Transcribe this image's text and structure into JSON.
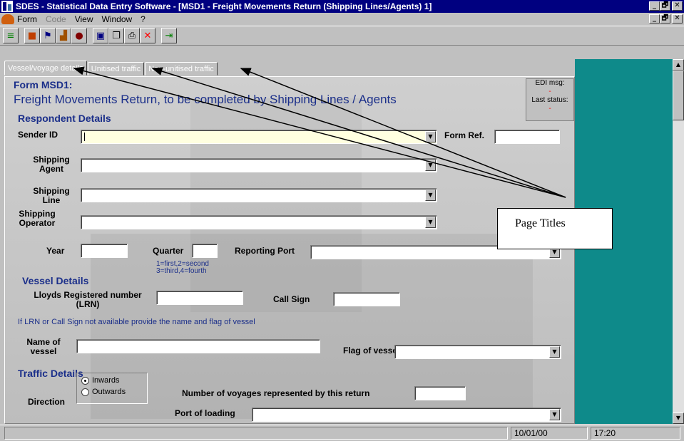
{
  "window": {
    "title": "SDES - Statistical Data Entry Software - [MSD1 - Freight Movements Return (Shipping Lines/Agents) 1]",
    "controls": {
      "minimize": "_",
      "restore": "🗗",
      "close": "✕"
    }
  },
  "menu": {
    "items": [
      {
        "label": "Form",
        "enabled": true
      },
      {
        "label": "Code",
        "enabled": false
      },
      {
        "label": "View",
        "enabled": true
      },
      {
        "label": "Window",
        "enabled": true
      },
      {
        "label": "?",
        "enabled": true
      }
    ]
  },
  "toolbar": {
    "icons": [
      "index-icon",
      "package-icon",
      "flag-icon",
      "chart-icon",
      "gear-icon",
      "save-icon",
      "copy-icon",
      "print-icon",
      "delete-icon",
      "exit-icon"
    ]
  },
  "tabs": [
    {
      "label": "Vessel/voyage details",
      "active": true
    },
    {
      "label": "Unitised traffic",
      "active": false
    },
    {
      "label": "Non-unitised traffic",
      "active": false
    }
  ],
  "form": {
    "code": "Form MSD1:",
    "subtitle": "Freight Movements Return, to be completed by Shipping Lines / Agents",
    "edi": {
      "msg_label": "EDI msg:",
      "msg_value": "-",
      "status_label": "Last status:",
      "status_value": "-"
    },
    "respondent": {
      "heading": "Respondent Details",
      "sender_id_label": "Sender ID",
      "sender_id_value": "",
      "form_ref_label": "Form Ref.",
      "shipping_agent_label_1": "Shipping",
      "shipping_agent_label_2": "Agent",
      "shipping_line_label_1": "Shipping",
      "shipping_line_label_2": "Line",
      "shipping_operator_label_1": "Shipping",
      "shipping_operator_label_2": "Operator",
      "year_label": "Year",
      "quarter_label": "Quarter",
      "quarter_hint_1": "1=first,2=second",
      "quarter_hint_2": "3=third,4=fourth",
      "reporting_port_label": "Reporting Port"
    },
    "vessel": {
      "heading": "Vessel Details",
      "lrn_label_1": "Lloyds Registered number",
      "lrn_label_2": "(LRN)",
      "call_sign_label": "Call Sign",
      "note": "If LRN or Call Sign not available provide the name and flag of vessel",
      "name_label_1": "Name of",
      "name_label_2": "vessel",
      "flag_label": "Flag of vessel"
    },
    "traffic": {
      "heading": "Traffic Details",
      "direction_label": "Direction",
      "inwards_label": "Inwards",
      "outwards_label": "Outwards",
      "direction_selected": "Inwards",
      "voyages_label": "Number of voyages represented by this return",
      "port_loading_label": "Port of loading"
    }
  },
  "status": {
    "date": "10/01/00",
    "time": "17:20"
  },
  "annotation": {
    "callout": "Page Titles"
  },
  "colors": {
    "titlebar": "#000080",
    "form_text": "#1b2f8a",
    "side_panel": "#0e8a8a",
    "input_highlight": "#ffffe0"
  }
}
